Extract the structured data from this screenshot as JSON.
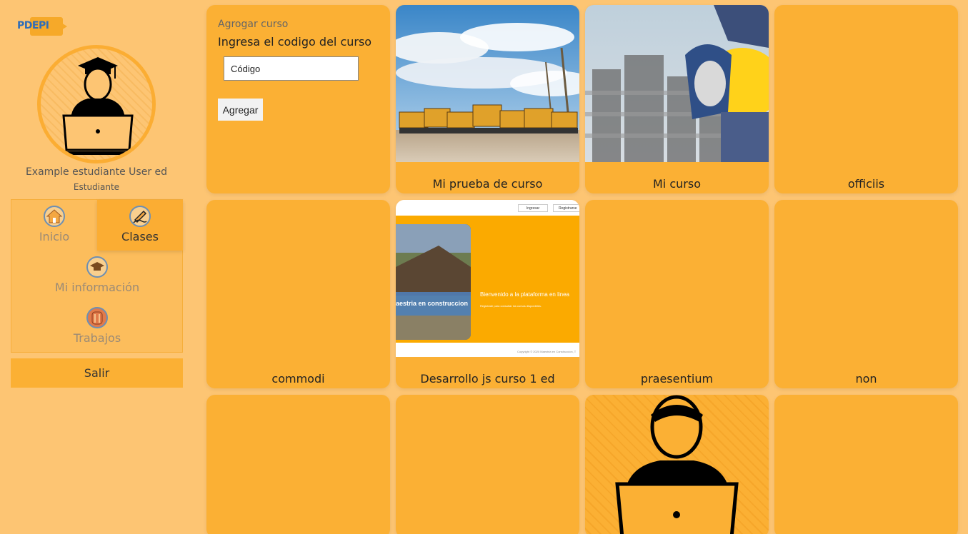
{
  "logo": {
    "text": "PDEPI"
  },
  "user": {
    "name": "Example estudiante User ed",
    "role": "Estudiante"
  },
  "menu": {
    "inicio": "Inicio",
    "clases": "Clases",
    "info": "Mi información",
    "trabajos": "Trabajos"
  },
  "logout": "Salir",
  "add_course": {
    "title": "Agrogar curso",
    "subtitle": "Ingresa el codigo del curso",
    "value": "Código",
    "button": "Agregar"
  },
  "courses": [
    {
      "title": "Mi prueba de curso"
    },
    {
      "title": "Mi curso"
    },
    {
      "title": "officiis"
    },
    {
      "title": "commodi"
    },
    {
      "title": "Desarrollo js curso 1 ed"
    },
    {
      "title": "praesentium"
    },
    {
      "title": "non"
    }
  ],
  "preview": {
    "btn_login": "Ingresar",
    "btn_register": "Registrarse",
    "card_caption": "aestria en construccion",
    "welcome": "Bienvenido a la plataforma en linea",
    "sub": "Registrate para consultar los cursos disponibles.",
    "footer": "Copyright © 2020 Maestria en Construccion, T"
  },
  "colors": {
    "accent": "#fbb034",
    "background": "#fdc573",
    "logo_blue": "#2f6db8"
  }
}
